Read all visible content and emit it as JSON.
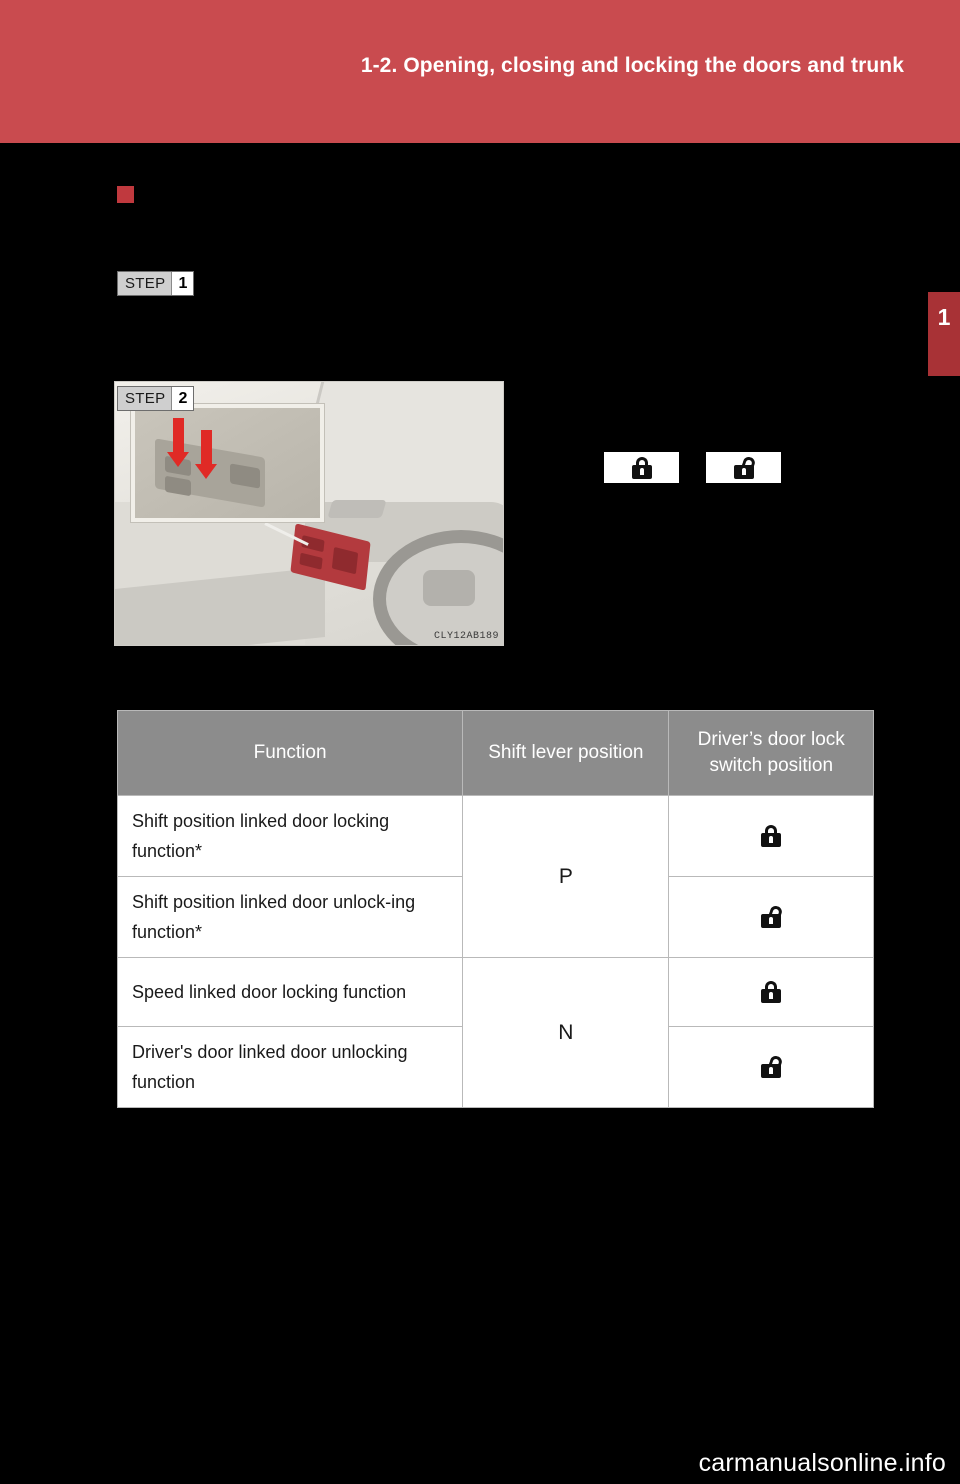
{
  "header": {
    "title": "1-2. Opening, closing and locking the doors and trunk",
    "band_color": "#c94b4f"
  },
  "chapter_tab": {
    "number": "1",
    "color": "#a83236"
  },
  "steps": {
    "step_word": "STEP",
    "step1_number": "1",
    "step2_number": "2"
  },
  "illustration": {
    "code": "CLY12AB189"
  },
  "inline_icons": {
    "lock_label": "lock-icon",
    "unlock_label": "unlock-icon"
  },
  "table": {
    "headers": {
      "function": "Function",
      "shift": "Shift lever position",
      "switch_line1": "Driver’s door lock",
      "switch_line2": "switch position"
    },
    "rows": [
      {
        "function": "Shift position linked door locking function*",
        "shift": "P",
        "switch": "lock"
      },
      {
        "function": "Shift position linked door unlock-ing function*",
        "shift": "",
        "switch": "unlock"
      },
      {
        "function": "Speed linked door locking function",
        "shift": "N",
        "switch": "lock"
      },
      {
        "function": "Driver's door linked door unlocking function",
        "shift": "",
        "switch": "unlock"
      }
    ]
  },
  "footer": {
    "site": "carmanualsonline.info"
  }
}
